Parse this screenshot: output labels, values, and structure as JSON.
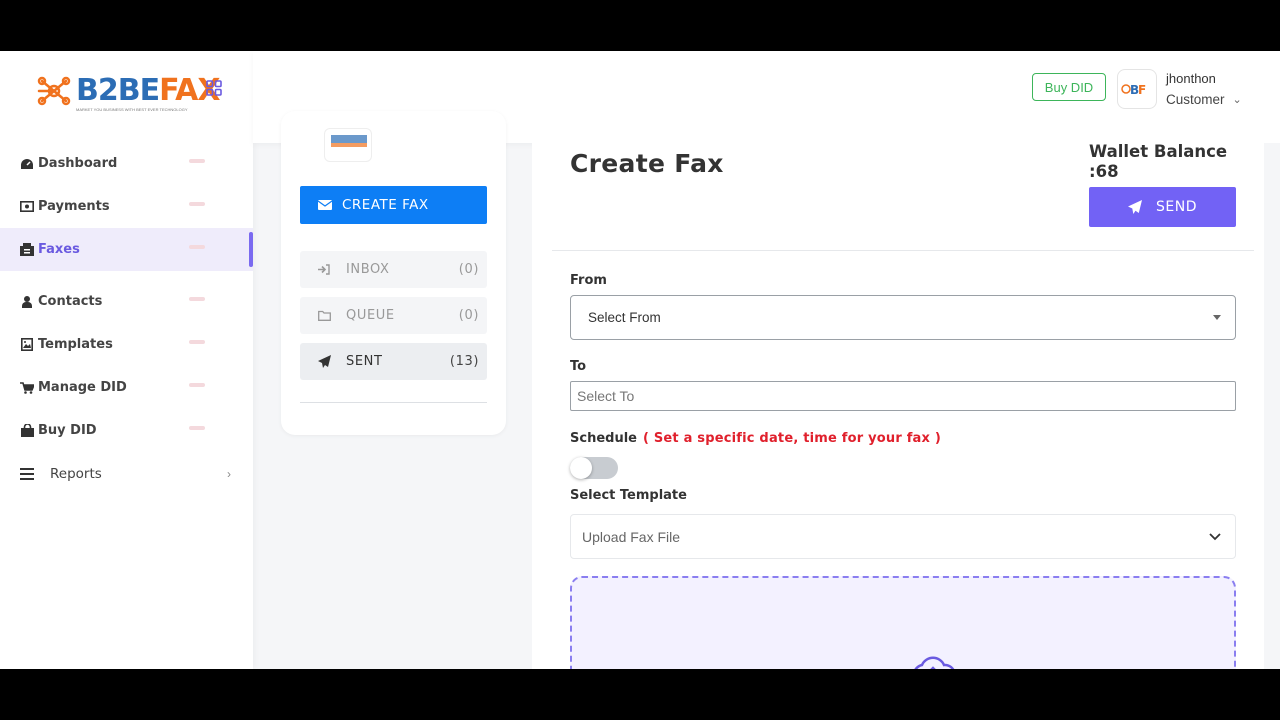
{
  "brand": {
    "logo_main": "B2BE",
    "logo_accent": "FAX",
    "tagline": "MARKET YOU BUSINESS WITH BEST EVER TECHNOLOGY",
    "primary_color": "#2c6db5",
    "accent_color": "#f0721e"
  },
  "sidebar": {
    "items": [
      {
        "label": "Dashboard",
        "icon": "dashboard-icon",
        "active": false
      },
      {
        "label": "Payments",
        "icon": "money-icon",
        "active": false
      },
      {
        "label": "Faxes",
        "icon": "fax-icon",
        "active": true
      },
      {
        "label": "Contacts",
        "icon": "user-icon",
        "active": false
      },
      {
        "label": "Templates",
        "icon": "image-icon",
        "active": false
      },
      {
        "label": "Manage DID",
        "icon": "cart-icon",
        "active": false
      },
      {
        "label": "Buy DID",
        "icon": "shopping-bag-icon",
        "active": false
      },
      {
        "label": "Reports",
        "icon": "menu-icon",
        "active": false
      }
    ],
    "active_color": "#6a5ae0"
  },
  "header": {
    "buy_did_label": "Buy DID",
    "username": "jhonthon",
    "role": "Customer"
  },
  "folders": {
    "create_label": "CREATE FAX",
    "items": [
      {
        "label": "INBOX",
        "count": "(0)"
      },
      {
        "label": "QUEUE",
        "count": "(0)"
      },
      {
        "label": "SENT",
        "count": "(13)"
      }
    ]
  },
  "form": {
    "title": "Create Fax",
    "wallet_label": "Wallet Balance",
    "wallet_value": ":68",
    "send_label": "SEND",
    "from_label": "From",
    "from_selected": "Select From",
    "to_label": "To",
    "to_placeholder": "Select To",
    "schedule_label": "Schedule",
    "schedule_hint": "( Set a specific date, time for your fax )",
    "schedule_enabled": false,
    "template_label": "Select Template",
    "template_selected": "Upload Fax File",
    "button_color": "#7262f5"
  }
}
